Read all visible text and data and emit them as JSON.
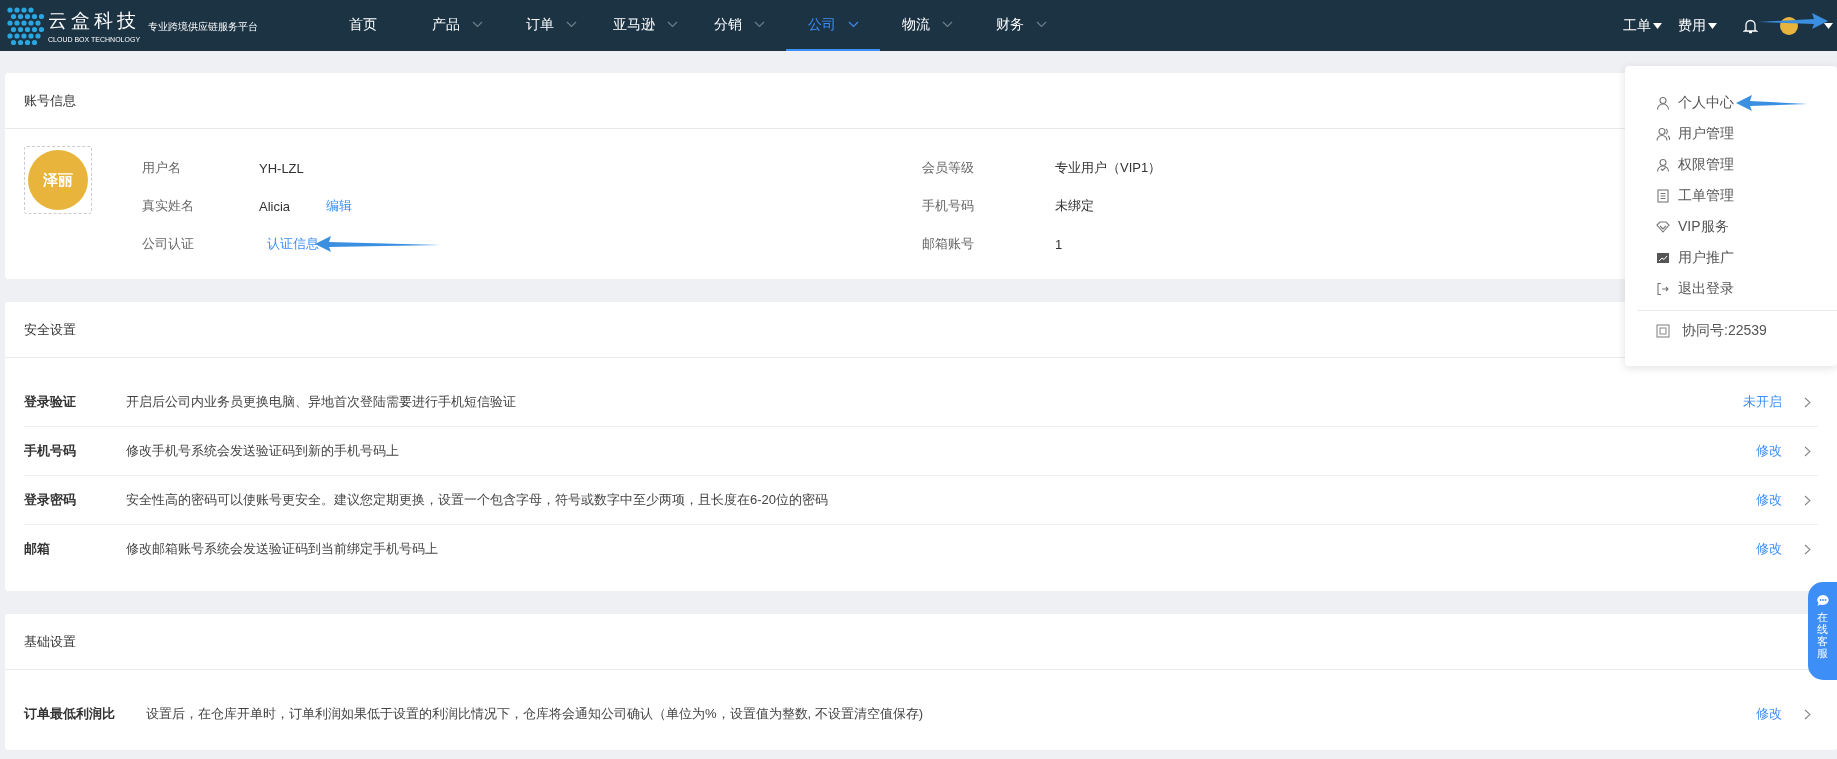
{
  "brand": {
    "name": "云盒科技",
    "subtitle": "CLOUD BOX TECHNOLOGY",
    "slogan": "专业跨境供应链服务平台"
  },
  "nav": {
    "items": [
      {
        "label": "首页",
        "has_menu": false,
        "selected": false
      },
      {
        "label": "产品",
        "has_menu": true,
        "selected": false
      },
      {
        "label": "订单",
        "has_menu": true,
        "selected": false
      },
      {
        "label": "亚马逊",
        "has_menu": true,
        "selected": false
      },
      {
        "label": "分销",
        "has_menu": true,
        "selected": false
      },
      {
        "label": "公司",
        "has_menu": true,
        "selected": true
      },
      {
        "label": "物流",
        "has_menu": true,
        "selected": false
      },
      {
        "label": "财务",
        "has_menu": true,
        "selected": false
      }
    ],
    "right_menus": [
      {
        "label": "工单"
      },
      {
        "label": "费用"
      }
    ],
    "user_arrow": true
  },
  "account": {
    "title": "账号信息",
    "avatar_text": "泽丽",
    "left_fields": [
      {
        "label": "用户名",
        "value": "YH-LZL"
      },
      {
        "label": "真实姓名",
        "value": "Alicia",
        "link": "编辑",
        "arrow": false
      },
      {
        "label": "公司认证",
        "link": "认证信息",
        "arrow": true
      }
    ],
    "right_fields": [
      {
        "label": "会员等级",
        "value": "专业用户（VIP1）"
      },
      {
        "label": "手机号码",
        "value": "未绑定"
      },
      {
        "label": "邮箱账号",
        "value": "1"
      }
    ]
  },
  "security": {
    "title": "安全设置",
    "rows": [
      {
        "label": "登录验证",
        "description": "开启后公司内业务员更换电脑、异地首次登陆需要进行手机短信验证",
        "action": "未开启"
      },
      {
        "label": "手机号码",
        "description": "修改手机号系统会发送验证码到新的手机号码上",
        "action": "修改"
      },
      {
        "label": "登录密码",
        "description": "安全性高的密码可以使账号更安全。建议您定期更换，设置一个包含字母，符号或数字中至少两项，且长度在6-20位的密码",
        "action": "修改"
      },
      {
        "label": "邮箱",
        "description": "修改邮箱账号系统会发送验证码到当前绑定手机号码上",
        "action": "修改"
      }
    ]
  },
  "basic": {
    "title": "基础设置",
    "rows": [
      {
        "label": "订单最低利润比",
        "description": "设置后，在仓库开单时，订单利润如果低于设置的利润比情况下，仓库将会通知公司确认（单位为%，设置值为整数, 不设置清空值保存)",
        "action": "修改"
      }
    ]
  },
  "user_menu": {
    "items": [
      {
        "label": "个人中心",
        "kind": "user",
        "arrow": true
      },
      {
        "label": "用户管理",
        "kind": "users",
        "arrow": false
      },
      {
        "label": "权限管理",
        "kind": "permission",
        "arrow": false
      },
      {
        "label": "工单管理",
        "kind": "ticket",
        "arrow": false
      },
      {
        "label": "VIP服务",
        "kind": "vip",
        "arrow": false
      },
      {
        "label": "用户推广",
        "kind": "promote",
        "arrow": false
      },
      {
        "label": "退出登录",
        "kind": "logout",
        "arrow": false
      }
    ],
    "footer": "协同号:22539"
  },
  "chat_button": {
    "label": "在线客服"
  }
}
